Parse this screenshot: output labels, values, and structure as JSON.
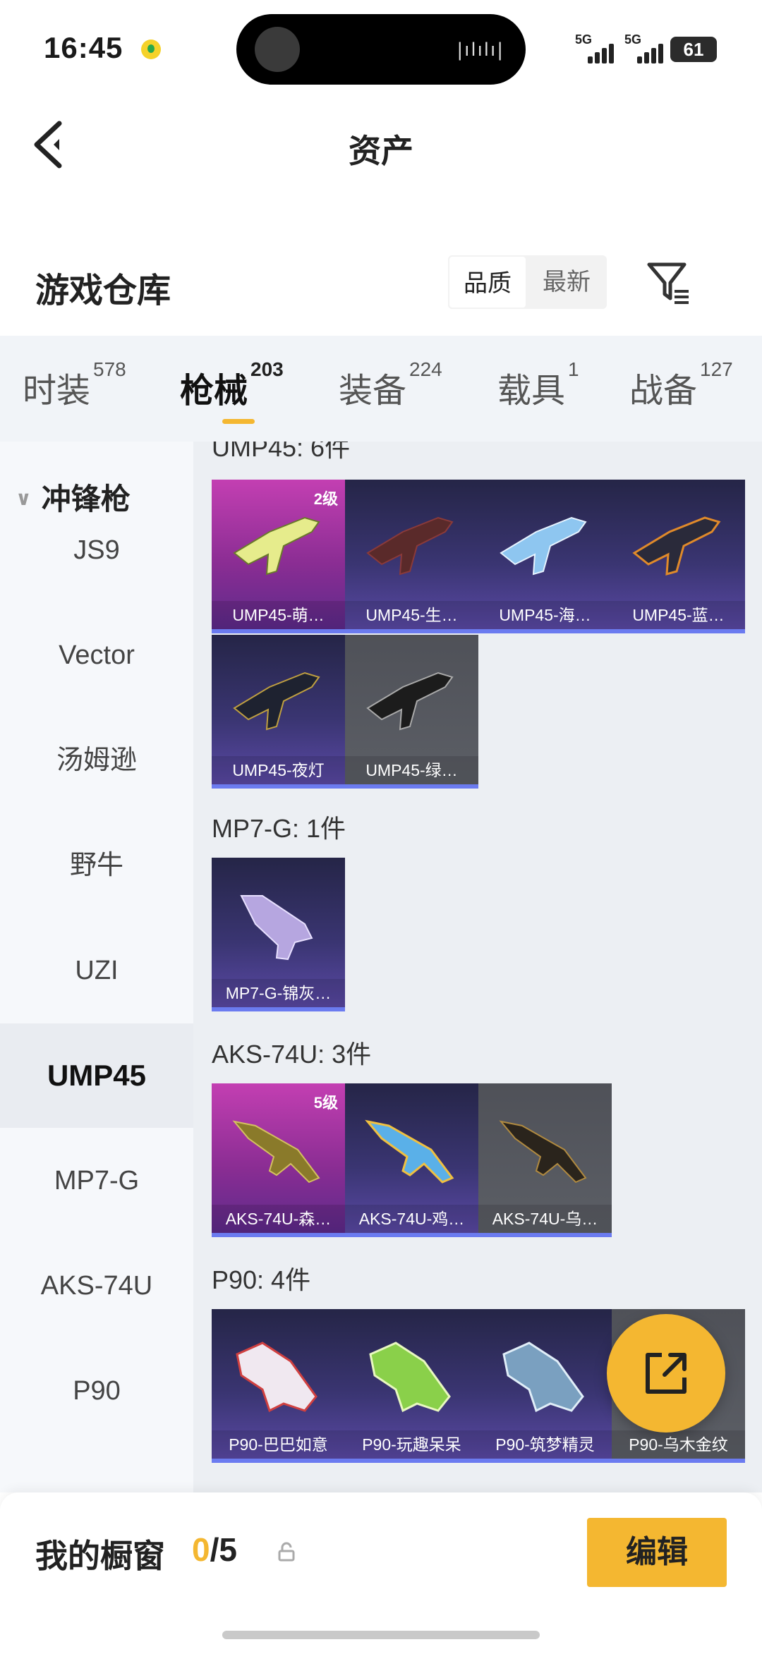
{
  "status": {
    "time": "16:45",
    "net1": "5G",
    "net2": "5G",
    "battery": "61"
  },
  "nav": {
    "title": "资产"
  },
  "warehouse": {
    "title": "游戏仓库",
    "sort_options": [
      "品质",
      "最新"
    ],
    "active_sort": "品质"
  },
  "tabs": [
    {
      "label": "时装",
      "count": "578"
    },
    {
      "label": "枪械",
      "count": "203"
    },
    {
      "label": "装备",
      "count": "224"
    },
    {
      "label": "载具",
      "count": "1"
    },
    {
      "label": "战备",
      "count": "127"
    }
  ],
  "sidebar": {
    "group": "冲锋枪",
    "items": [
      "JS9",
      "Vector",
      "汤姆逊",
      "野牛",
      "UZI",
      "UMP45",
      "MP7-G",
      "AKS-74U",
      "P90"
    ],
    "active": "UMP45"
  },
  "sections": [
    {
      "title": "UMP45: 6件",
      "items": [
        {
          "label": "UMP45-萌…",
          "level": "2级",
          "rarity": "pink"
        },
        {
          "label": "UMP45-生…",
          "level": "",
          "rarity": "purple"
        },
        {
          "label": "UMP45-海…",
          "level": "",
          "rarity": "purple"
        },
        {
          "label": "UMP45-蓝…",
          "level": "",
          "rarity": "purple"
        },
        {
          "label": "UMP45-夜灯",
          "level": "",
          "rarity": "purple"
        },
        {
          "label": "UMP45-绿…",
          "level": "",
          "rarity": "gray"
        }
      ]
    },
    {
      "title": "MP7-G: 1件",
      "items": [
        {
          "label": "MP7-G-锦灰…",
          "level": "",
          "rarity": "purple"
        }
      ]
    },
    {
      "title": "AKS-74U: 3件",
      "items": [
        {
          "label": "AKS-74U-森…",
          "level": "5级",
          "rarity": "pink"
        },
        {
          "label": "AKS-74U-鸡…",
          "level": "",
          "rarity": "purple"
        },
        {
          "label": "AKS-74U-乌…",
          "level": "",
          "rarity": "gray"
        }
      ]
    },
    {
      "title": "P90: 4件",
      "items": [
        {
          "label": "P90-巴巴如意",
          "level": "",
          "rarity": "purple"
        },
        {
          "label": "P90-玩趣呆呆",
          "level": "",
          "rarity": "purple"
        },
        {
          "label": "P90-筑梦精灵",
          "level": "",
          "rarity": "purple"
        },
        {
          "label": "P90-乌木金纹",
          "level": "",
          "rarity": "gray"
        }
      ]
    }
  ],
  "bottom": {
    "showcase_label": "我的橱窗",
    "showcase_current": "0",
    "showcase_total": "/5",
    "edit_label": "编辑"
  },
  "colors": {
    "accent": "#f4b731",
    "rarity_pink": "#c33fb2",
    "rarity_purple": "#3a3572",
    "rarity_gray": "#5c5f66"
  }
}
